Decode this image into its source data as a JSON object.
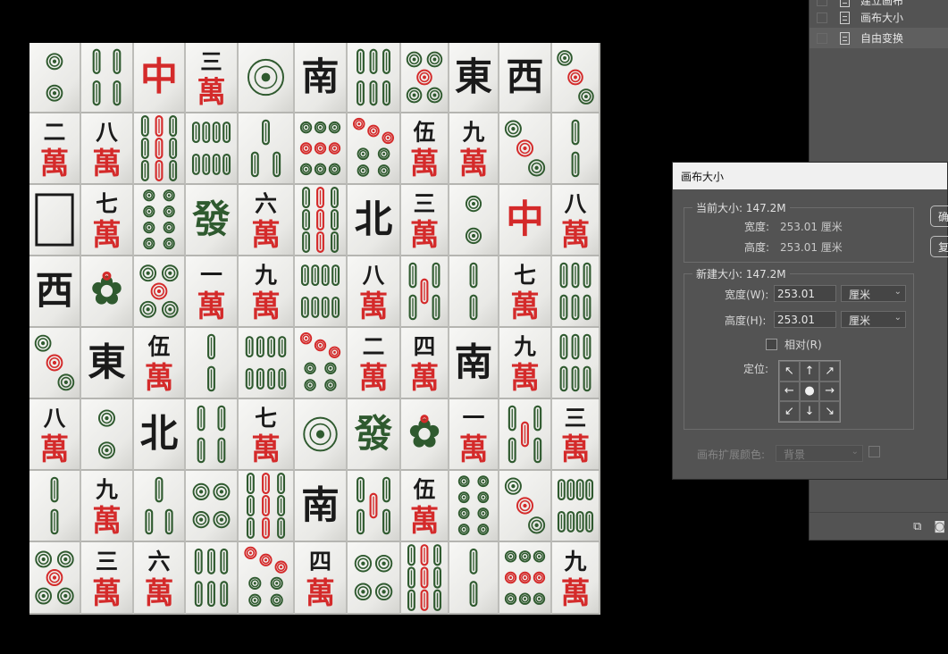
{
  "layers_panel": {
    "rows": [
      {
        "label": "建立画布",
        "active": false
      },
      {
        "label": "画布大小",
        "active": false
      },
      {
        "label": "自由变换",
        "active": true
      }
    ],
    "footer_icons": [
      "new-layer-icon",
      "camera-icon"
    ]
  },
  "dialog": {
    "title": "画布大小",
    "current": {
      "legend": "当前大小: 147.2M",
      "width_label": "宽度:",
      "width_value": "253.01 厘米",
      "height_label": "高度:",
      "height_value": "253.01 厘米"
    },
    "new": {
      "legend": "新建大小: 147.2M",
      "width_label": "宽度(W):",
      "width_value": "253.01",
      "width_unit": "厘米",
      "height_label": "高度(H):",
      "height_value": "253.01",
      "height_unit": "厘米",
      "relative_label": "相对(R)",
      "relative_checked": false,
      "anchor_label": "定位:",
      "anchor_arrows": [
        "↖",
        "↑",
        "↗",
        "←",
        "●",
        "→",
        "↙",
        "↓",
        "↘"
      ]
    },
    "extension_color_label": "画布扩展颜色:",
    "extension_color_value": "背景",
    "ok_label": "确",
    "cancel_label": "复"
  },
  "tiles": {
    "colors": {
      "red": "#d42a2a",
      "black": "#1a1a1a",
      "green": "#2f5a2f"
    },
    "rows": [
      [
        "c2",
        "b4",
        "red",
        "m3",
        "c1",
        "nan",
        "b6",
        "c5",
        "dong",
        "xi",
        "c3"
      ],
      [
        "m2",
        "m8",
        "b9",
        "b8",
        "b3",
        "c9",
        "c7",
        "m5",
        "m9",
        "c3",
        "b2"
      ],
      [
        "blank",
        "m7",
        "c8",
        "fa",
        "m6",
        "b9",
        "bei",
        "m3",
        "c2",
        "red",
        "m8"
      ],
      [
        "xi",
        "b1",
        "c5",
        "m1",
        "m9",
        "b8",
        "m8",
        "b5",
        "b2",
        "m7",
        "b6"
      ],
      [
        "c3",
        "dong",
        "m5",
        "b2",
        "b8",
        "c7",
        "m2",
        "m4",
        "nan",
        "m9",
        "b6"
      ],
      [
        "m8",
        "c2",
        "bei",
        "b4",
        "m7",
        "c1",
        "fa",
        "b1",
        "m1",
        "b5",
        "m3"
      ],
      [
        "b2",
        "m9",
        "b3",
        "c4",
        "b9",
        "nan",
        "b5",
        "m5",
        "c8",
        "c3",
        "b8"
      ],
      [
        "c5",
        "m3",
        "m6",
        "b6",
        "c7",
        "m4",
        "c4",
        "b9",
        "b2",
        "c9",
        "m9"
      ]
    ],
    "glyphs": {
      "red": "中",
      "fa": "發",
      "dong": "東",
      "nan": "南",
      "xi": "西",
      "bei": "北",
      "wan": "萬",
      "numerals": [
        "",
        "一",
        "二",
        "三",
        "四",
        "伍",
        "六",
        "七",
        "八",
        "九"
      ]
    }
  }
}
